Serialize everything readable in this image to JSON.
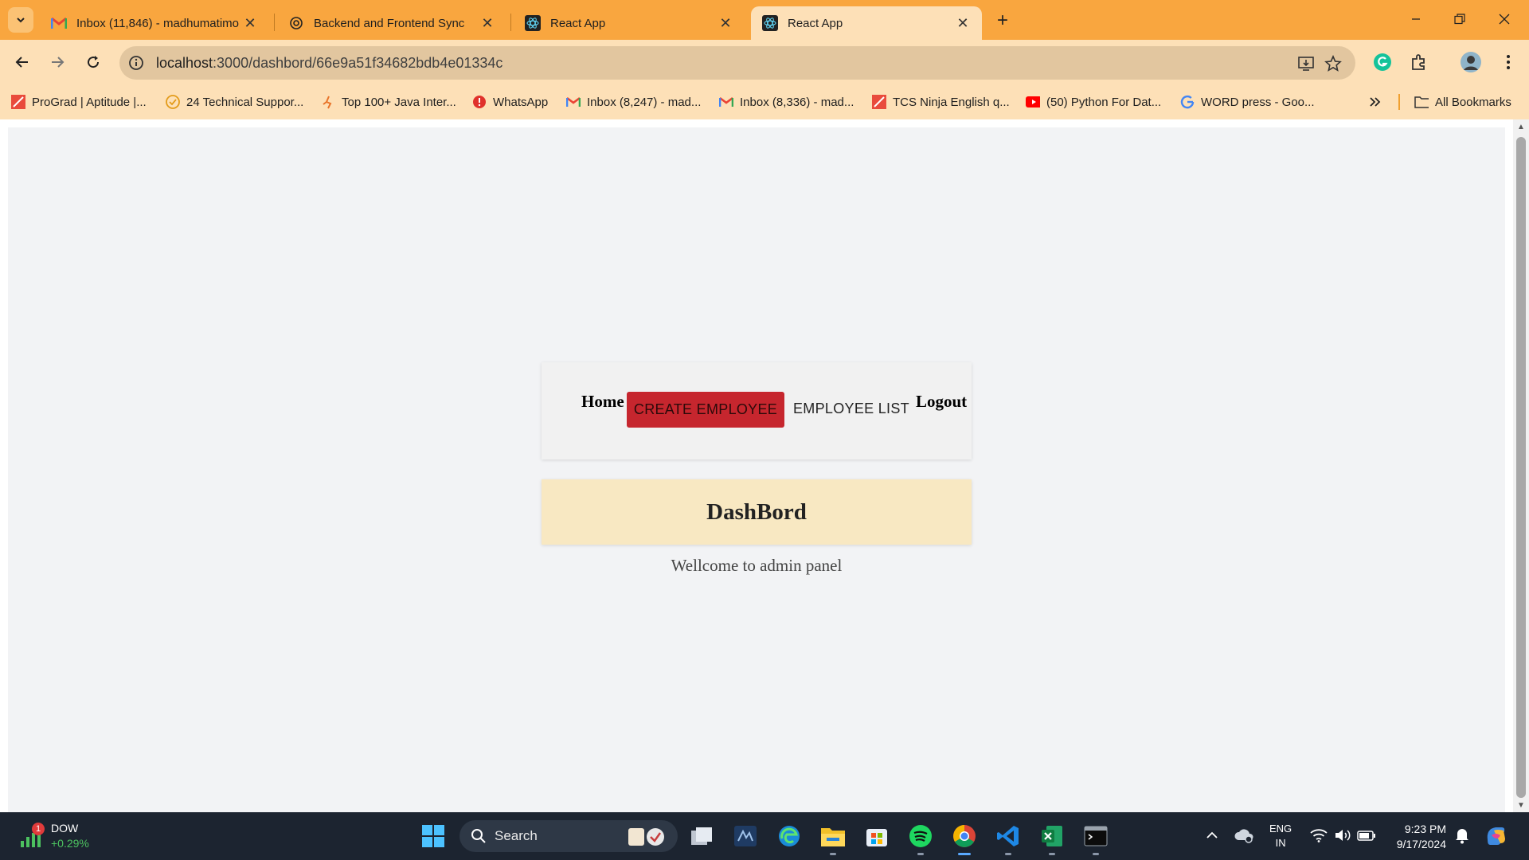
{
  "browser": {
    "tabs": [
      {
        "title": "Inbox (11,846) - madhumatimo",
        "icon": "gmail-icon",
        "active": false
      },
      {
        "title": "Backend and Frontend Sync",
        "icon": "chatgpt-icon",
        "active": false
      },
      {
        "title": "React App",
        "icon": "react-icon",
        "active": false
      },
      {
        "title": "React App",
        "icon": "react-icon",
        "active": true
      }
    ],
    "url_host": "localhost",
    "url_rest": ":3000/dashbord/66e9a51f34682bdb4e01334c",
    "bookmarks": [
      {
        "label": "ProGrad | Aptitude |...",
        "icon": "prograd-icon"
      },
      {
        "label": "24 Technical Suppor...",
        "icon": "check-badge-icon"
      },
      {
        "label": "Top 100+ Java Inter...",
        "icon": "runner-icon"
      },
      {
        "label": "WhatsApp",
        "icon": "alert-icon"
      },
      {
        "label": "Inbox (8,247) - mad...",
        "icon": "gmail-icon"
      },
      {
        "label": "Inbox (8,336) - mad...",
        "icon": "gmail-icon"
      },
      {
        "label": "TCS Ninja English q...",
        "icon": "prograd-icon"
      },
      {
        "label": "(50) Python For Dat...",
        "icon": "youtube-icon"
      },
      {
        "label": "WORD press - Goo...",
        "icon": "google-icon"
      }
    ],
    "all_bookmarks": "All Bookmarks"
  },
  "app": {
    "nav": {
      "home": "Home",
      "create": "CREATE EMPLOYEE",
      "list": "EMPLOYEE LIST",
      "logout": "Logout"
    },
    "dashboard_title": "DashBord",
    "welcome": "Wellcome to admin panel"
  },
  "taskbar": {
    "widget_name": "DOW",
    "widget_change": "+0.29%",
    "widget_badge": "1",
    "search_label": "Search",
    "lang_top": "ENG",
    "lang_bottom": "IN",
    "time": "9:23 PM",
    "date": "9/17/2024"
  },
  "colors": {
    "tabbar": "#f9a63f",
    "toolbar": "#fde0b7",
    "create_button": "#c6262e",
    "dashboard_card": "#f8e8c2",
    "page_bg": "#f2f3f5"
  }
}
